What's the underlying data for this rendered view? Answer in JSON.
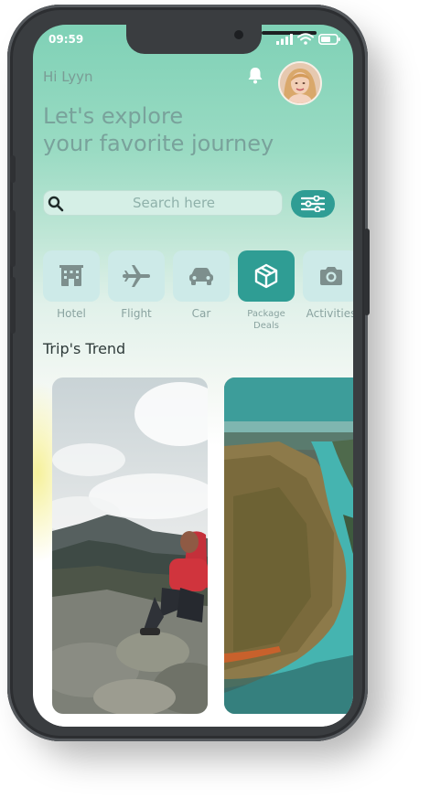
{
  "status_bar": {
    "time": "09:59"
  },
  "header": {
    "greeting": "Hi Lyyn",
    "headline_line1": "Let's explore",
    "headline_line2": "your favorite journey"
  },
  "search": {
    "placeholder": "Search here"
  },
  "categories": [
    {
      "label": "Hotel",
      "icon": "hotel-icon",
      "active": false
    },
    {
      "label": "Flight",
      "icon": "airplane-icon",
      "active": false
    },
    {
      "label": "Car",
      "icon": "car-icon",
      "active": false
    },
    {
      "label": "Package Deals",
      "icon": "package-icon",
      "active": true
    },
    {
      "label": "Activities",
      "icon": "camera-icon",
      "active": false
    }
  ],
  "trends": {
    "title": "Trip's Trend",
    "cards": [
      {
        "scene": "hiker-on-mountain-summit"
      },
      {
        "scene": "river-canyon-aerial"
      }
    ]
  },
  "colors": {
    "accent": "#2f9d94",
    "header_gradient_top": "#7fd1b6",
    "tile_bg": "#cdeae8",
    "muted_text": "#79a29b"
  }
}
